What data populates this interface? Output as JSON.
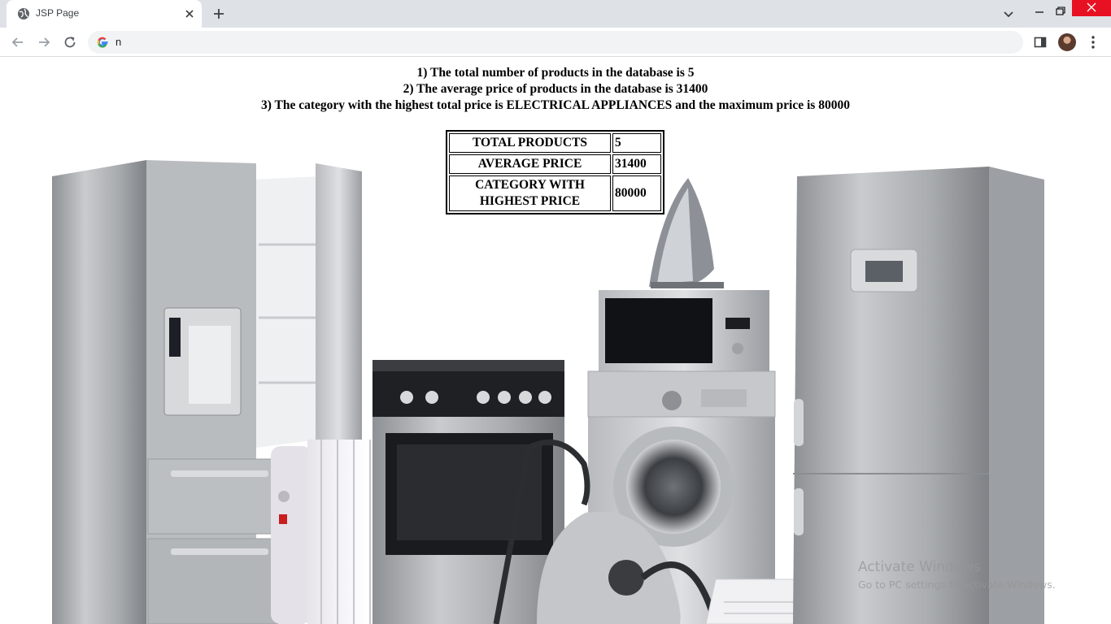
{
  "browser": {
    "tab_title": "JSP Page",
    "address_text": "n"
  },
  "page": {
    "lines": [
      "1) The total number of products in the database is 5",
      "2) The average price of products in the database is 31400",
      "3) The category with the highest total price is ELECTRICAL APPLIANCES and the maximum price is 80000"
    ],
    "table": {
      "rows": [
        {
          "label": "TOTAL PRODUCTS",
          "value": "5"
        },
        {
          "label": "AVERAGE PRICE",
          "value": "31400"
        },
        {
          "label_line1": "CATEGORY WITH",
          "label_line2": "HIGHEST PRICE",
          "value": "80000"
        }
      ]
    },
    "background_image": "home-appliances-photo"
  },
  "os": {
    "watermark_title": "Activate Windows",
    "watermark_sub": "Go to PC settings to activate Windows."
  },
  "colors": {
    "chrome_bg": "#dee1e6",
    "close_red": "#e81123",
    "omnibox_bg": "#f1f3f4"
  }
}
